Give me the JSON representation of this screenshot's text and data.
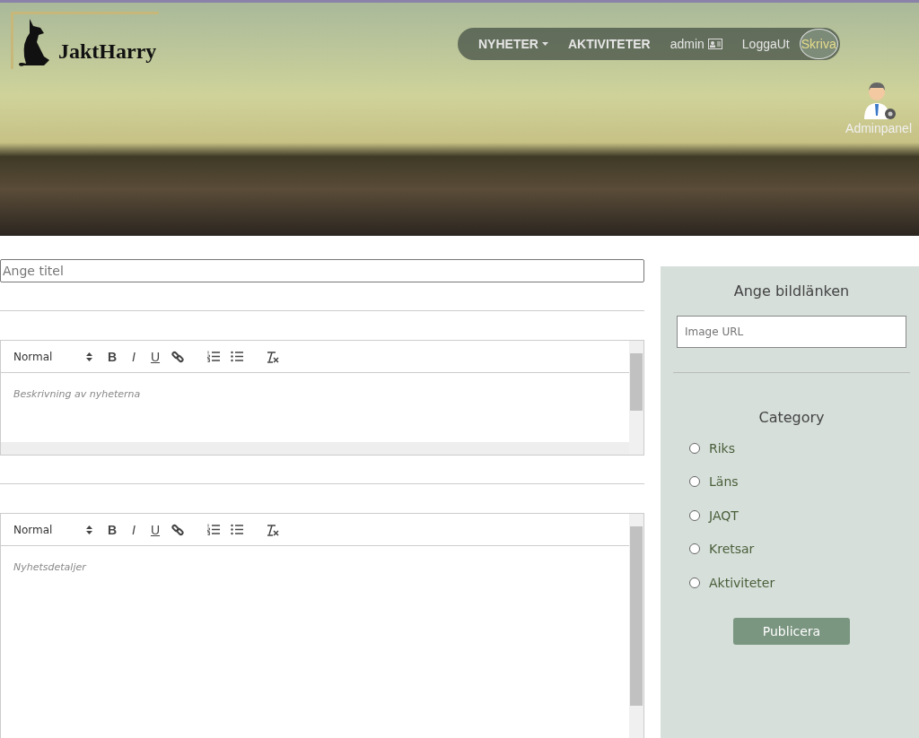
{
  "header": {
    "logo": "JaktHarry",
    "nav": [
      {
        "label": "NYHETER",
        "kind": "dropdown",
        "selected": false
      },
      {
        "label": "AKTIVITETER",
        "kind": "link",
        "selected": false
      },
      {
        "label": "admin",
        "kind": "user",
        "selected": false
      },
      {
        "label": "LoggaUt",
        "kind": "link",
        "selected": false
      },
      {
        "label": "Skriva",
        "kind": "link",
        "selected": true
      }
    ],
    "admin_panel": "Adminpanel"
  },
  "title_field": {
    "placeholder": "Ange titel"
  },
  "editors": [
    {
      "format": "Normal",
      "tools": [
        "B",
        "I",
        "U"
      ],
      "placeholder": "Beskrivning av nyheterna",
      "h_scrollbar": true
    },
    {
      "format": "Normal",
      "tools": [
        "B",
        "I",
        "U"
      ],
      "placeholder": "Nyhetsdetaljer",
      "h_scrollbar": false
    }
  ],
  "side": {
    "image_heading": "Ange bildlänken",
    "image_field": {
      "placeholder": "Image URL"
    },
    "category_heading": "Category",
    "categories": [
      {
        "label": "Riks",
        "selected": false
      },
      {
        "label": "Läns",
        "selected": false
      },
      {
        "label": "JAQT",
        "selected": false
      },
      {
        "label": "Kretsar",
        "selected": false
      },
      {
        "label": "Aktiviteter",
        "selected": false
      }
    ],
    "publish": "Publicera"
  }
}
